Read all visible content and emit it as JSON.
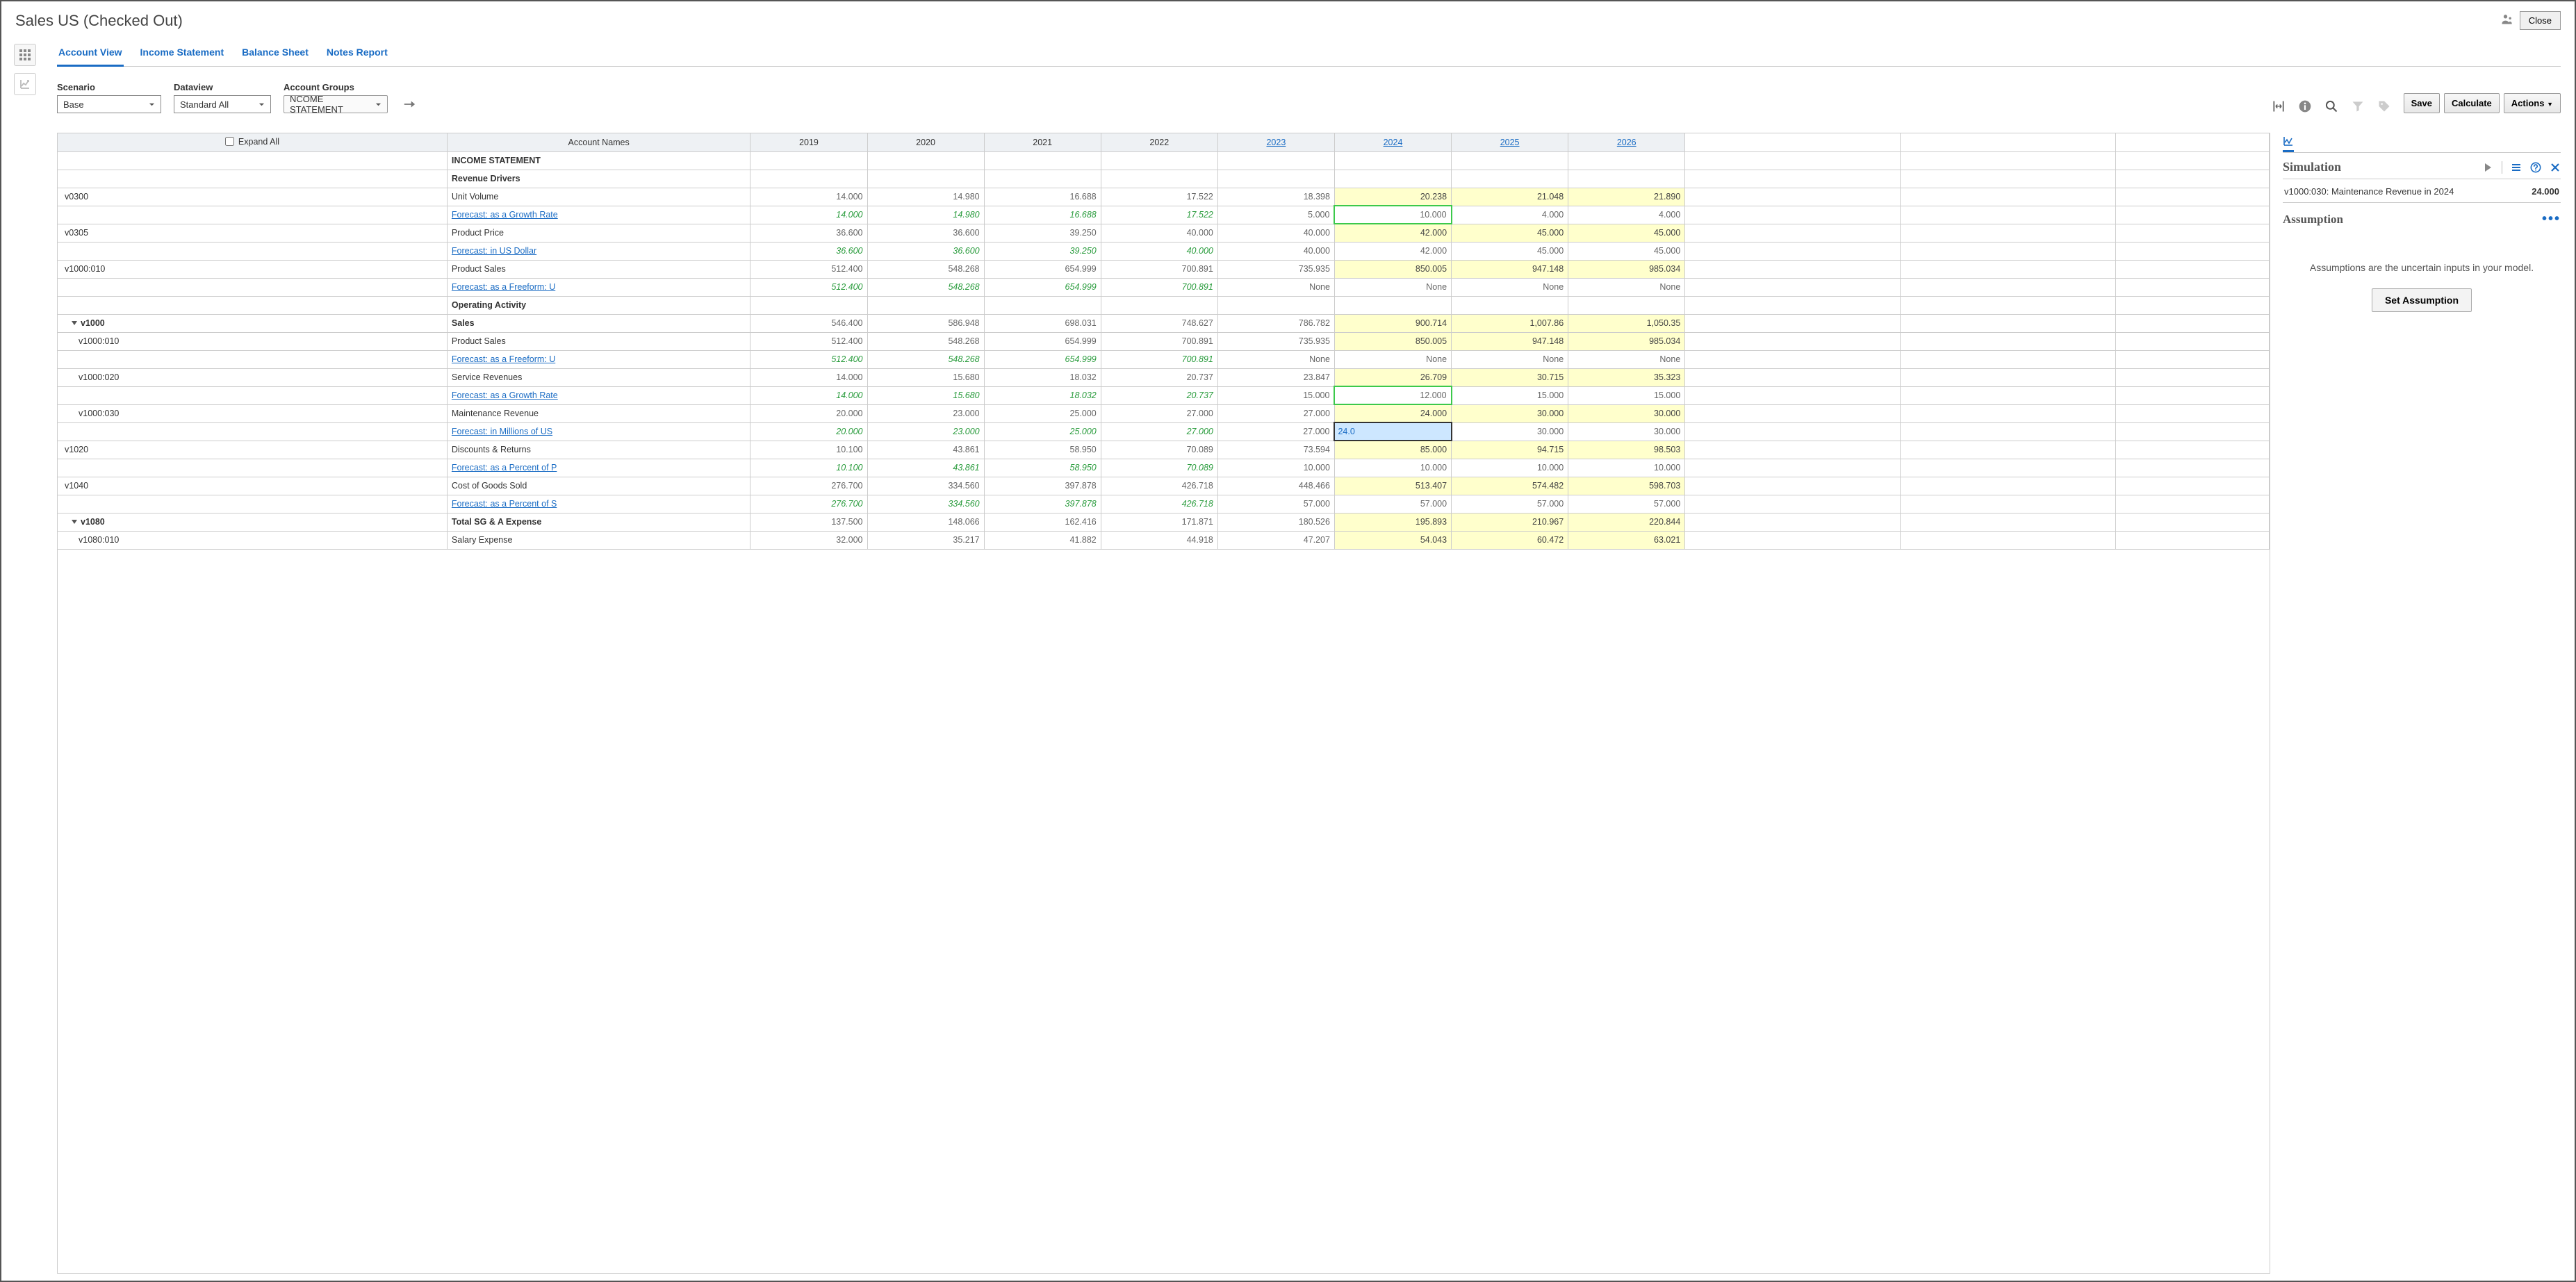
{
  "header": {
    "title": "Sales US (Checked Out)",
    "close_label": "Close"
  },
  "tabs": [
    {
      "label": "Account View",
      "active": true
    },
    {
      "label": "Income Statement",
      "active": false
    },
    {
      "label": "Balance Sheet",
      "active": false
    },
    {
      "label": "Notes Report",
      "active": false
    }
  ],
  "controls": {
    "scenario_label": "Scenario",
    "scenario_value": "Base",
    "dataview_label": "Dataview",
    "dataview_value": "Standard All",
    "accountgroups_label": "Account Groups",
    "accountgroups_value": "NCOME STATEMENT",
    "save_label": "Save",
    "calculate_label": "Calculate",
    "actions_label": "Actions"
  },
  "grid": {
    "expand_all_label": "Expand All",
    "account_names_header": "Account Names",
    "years": [
      "2019",
      "2020",
      "2021",
      "2022",
      "2023",
      "2024",
      "2025",
      "2026"
    ],
    "year_link_from_index": 4,
    "rows": [
      {
        "type": "section",
        "code": "",
        "name": "INCOME STATEMENT"
      },
      {
        "type": "section",
        "code": "",
        "name": "Revenue Drivers"
      },
      {
        "type": "data",
        "code": "v0300",
        "name": "Unit Volume",
        "vals": [
          "14.000",
          "14.980",
          "16.688",
          "17.522",
          "18.398",
          "20.238",
          "21.048",
          "21.890"
        ],
        "fc_from": 5
      },
      {
        "type": "forecast",
        "link": "Forecast: as a Growth Rate",
        "vals": [
          "14.000",
          "14.980",
          "16.688",
          "17.522",
          "5.000",
          "10.000",
          "4.000",
          "4.000"
        ],
        "green_to": 3,
        "greenbox": 5
      },
      {
        "type": "data",
        "code": "v0305",
        "name": "Product Price",
        "vals": [
          "36.600",
          "36.600",
          "39.250",
          "40.000",
          "40.000",
          "42.000",
          "45.000",
          "45.000"
        ],
        "fc_from": 5
      },
      {
        "type": "forecast",
        "link": "Forecast: in US Dollar",
        "vals": [
          "36.600",
          "36.600",
          "39.250",
          "40.000",
          "40.000",
          "42.000",
          "45.000",
          "45.000"
        ],
        "green_to": 3
      },
      {
        "type": "data",
        "code": "v1000:010",
        "name": "Product Sales",
        "vals": [
          "512.400",
          "548.268",
          "654.999",
          "700.891",
          "735.935",
          "850.005",
          "947.148",
          "985.034"
        ],
        "fc_from": 5
      },
      {
        "type": "forecast",
        "link": "Forecast: as a Freeform: U",
        "vals": [
          "512.400",
          "548.268",
          "654.999",
          "700.891",
          "None",
          "None",
          "None",
          "None"
        ],
        "green_to": 3
      },
      {
        "type": "section",
        "code": "",
        "name": "Operating Activity"
      },
      {
        "type": "data",
        "code": "v1000",
        "name": "Sales",
        "bold": true,
        "tree": true,
        "indent": 1,
        "vals": [
          "546.400",
          "586.948",
          "698.031",
          "748.627",
          "786.782",
          "900.714",
          "1,007.86",
          "1,050.35"
        ],
        "fc_from": 5
      },
      {
        "type": "data",
        "code": "v1000:010",
        "name": "Product Sales",
        "indent": 2,
        "vals": [
          "512.400",
          "548.268",
          "654.999",
          "700.891",
          "735.935",
          "850.005",
          "947.148",
          "985.034"
        ],
        "fc_from": 5
      },
      {
        "type": "forecast",
        "link": "Forecast: as a Freeform: U",
        "vals": [
          "512.400",
          "548.268",
          "654.999",
          "700.891",
          "None",
          "None",
          "None",
          "None"
        ],
        "green_to": 3
      },
      {
        "type": "data",
        "code": "v1000:020",
        "name": "Service Revenues",
        "indent": 2,
        "vals": [
          "14.000",
          "15.680",
          "18.032",
          "20.737",
          "23.847",
          "26.709",
          "30.715",
          "35.323"
        ],
        "fc_from": 5
      },
      {
        "type": "forecast",
        "link": "Forecast: as a Growth Rate",
        "vals": [
          "14.000",
          "15.680",
          "18.032",
          "20.737",
          "15.000",
          "12.000",
          "15.000",
          "15.000"
        ],
        "green_to": 3,
        "greenbox": 5
      },
      {
        "type": "data",
        "code": "v1000:030",
        "name": "Maintenance Revenue",
        "indent": 2,
        "vals": [
          "20.000",
          "23.000",
          "25.000",
          "27.000",
          "27.000",
          "24.000",
          "30.000",
          "30.000"
        ],
        "fc_from": 5
      },
      {
        "type": "forecast",
        "link": "Forecast: in Millions of US",
        "vals": [
          "20.000",
          "23.000",
          "25.000",
          "27.000",
          "27.000",
          "24.0",
          "30.000",
          "30.000"
        ],
        "green_to": 3,
        "edit": 5
      },
      {
        "type": "data",
        "code": "v1020",
        "name": "Discounts & Returns",
        "vals": [
          "10.100",
          "43.861",
          "58.950",
          "70.089",
          "73.594",
          "85.000",
          "94.715",
          "98.503"
        ],
        "fc_from": 5
      },
      {
        "type": "forecast",
        "link": "Forecast: as a Percent of P",
        "vals": [
          "10.100",
          "43.861",
          "58.950",
          "70.089",
          "10.000",
          "10.000",
          "10.000",
          "10.000"
        ],
        "green_to": 3
      },
      {
        "type": "data",
        "code": "v1040",
        "name": "Cost of Goods Sold",
        "vals": [
          "276.700",
          "334.560",
          "397.878",
          "426.718",
          "448.466",
          "513.407",
          "574.482",
          "598.703"
        ],
        "fc_from": 5
      },
      {
        "type": "forecast",
        "link": "Forecast: as a Percent of S",
        "vals": [
          "276.700",
          "334.560",
          "397.878",
          "426.718",
          "57.000",
          "57.000",
          "57.000",
          "57.000"
        ],
        "green_to": 3
      },
      {
        "type": "data",
        "code": "v1080",
        "name": "Total SG & A Expense",
        "bold": true,
        "tree": true,
        "indent": 1,
        "vals": [
          "137.500",
          "148.066",
          "162.416",
          "171.871",
          "180.526",
          "195.893",
          "210.967",
          "220.844"
        ],
        "fc_from": 5
      },
      {
        "type": "data",
        "code": "v1080:010",
        "name": "Salary Expense",
        "indent": 2,
        "vals": [
          "32.000",
          "35.217",
          "41.882",
          "44.918",
          "47.207",
          "54.043",
          "60.472",
          "63.021"
        ],
        "fc_from": 5
      }
    ]
  },
  "simulation": {
    "panel_title": "Simulation",
    "detail_label": "v1000:030: Maintenance Revenue in 2024",
    "detail_value": "24.000",
    "assumption_title": "Assumption",
    "assumption_text": "Assumptions are the uncertain inputs in your model.",
    "set_assumption_label": "Set Assumption"
  }
}
